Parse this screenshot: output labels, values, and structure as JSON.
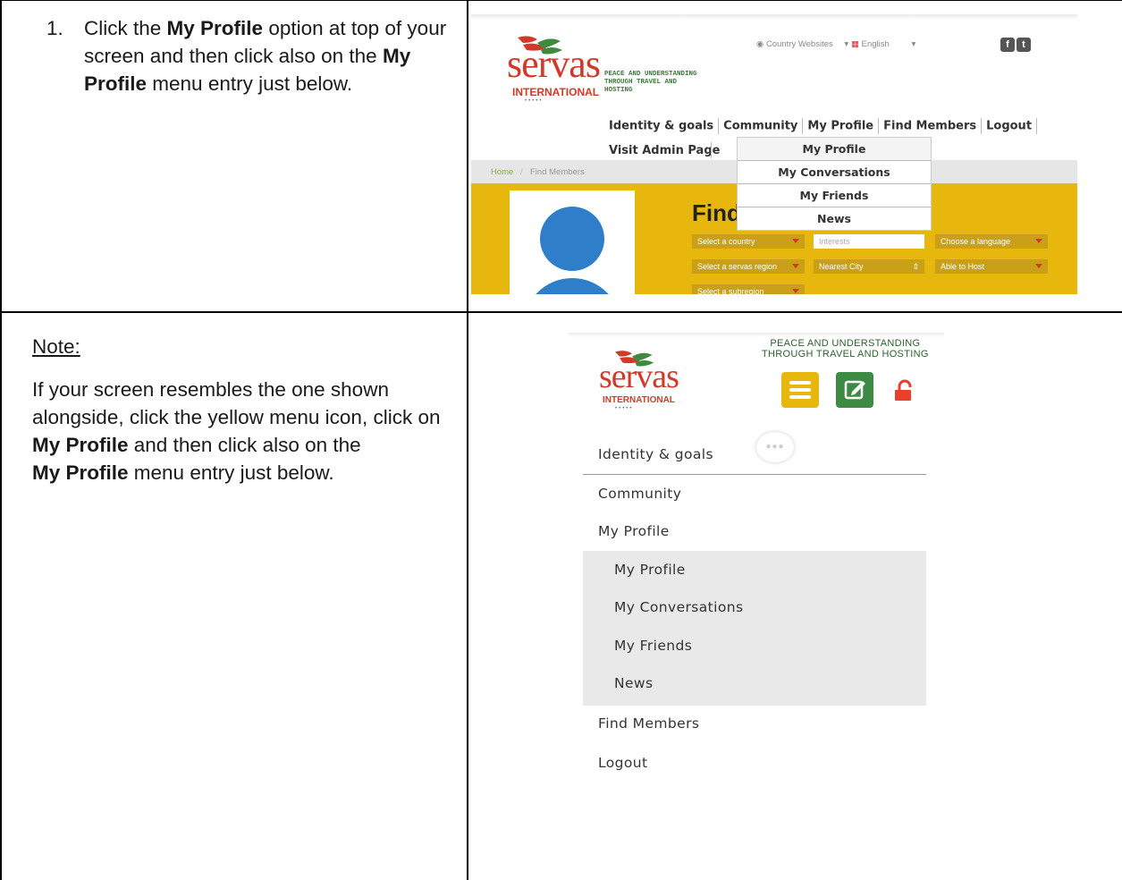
{
  "step1": {
    "number": "1.",
    "text_before": "Click the ",
    "bold1": "My Profile",
    "text_middle": " option at top of your screen and then click also on the ",
    "bold2": "My Profile",
    "text_after": " menu entry just below."
  },
  "note": {
    "heading": "Note:",
    "text_before": "If your screen resembles the one shown alongside, click the yellow menu icon, click on ",
    "bold1": "My Profile",
    "text_middle": " and then click also on the",
    "bold2": "My Profile",
    "text_after": " menu entry just below."
  },
  "screenshot1": {
    "logo": {
      "word": "servas",
      "intl": "INTERNATIONAL",
      "dots": "•••••"
    },
    "tagline": [
      "PEACE AND UNDERSTANDING",
      "THROUGH TRAVEL AND",
      "HOSTING"
    ],
    "country_websites": "Country Websites",
    "language": "English",
    "nav": [
      "Identity & goals",
      "Community",
      "My Profile",
      "Find Members",
      "Logout"
    ],
    "visit_admin": "Visit Admin Page",
    "breadcrumb": {
      "home": "Home",
      "sep": "/",
      "current": "Find Members"
    },
    "title_partial": "Find M",
    "filters": {
      "country": "Select a country",
      "interests": "Interests",
      "language": "Choose a language",
      "region": "Select a servas region",
      "city": "Nearest City",
      "host": "Able to Host",
      "subregion": "Select a subregion"
    },
    "dropdown": [
      "My Profile",
      "My Conversations",
      "My Friends",
      "News"
    ]
  },
  "screenshot2": {
    "tagline": [
      "PEACE AND UNDERSTANDING",
      "THROUGH TRAVEL AND HOSTING"
    ],
    "logo": {
      "word": "servas",
      "intl": "INTERNATIONAL",
      "dots": "•••••"
    },
    "menu": [
      "Identity & goals",
      "Community",
      "My Profile"
    ],
    "submenu": [
      "My Profile",
      "My Conversations",
      "My Friends",
      "News"
    ],
    "menu_after": [
      "Find Members",
      "Logout"
    ],
    "colors": {
      "menu_button": "#e8b70e",
      "edit_button": "#3d8a45",
      "lock": "#e8402c"
    }
  }
}
